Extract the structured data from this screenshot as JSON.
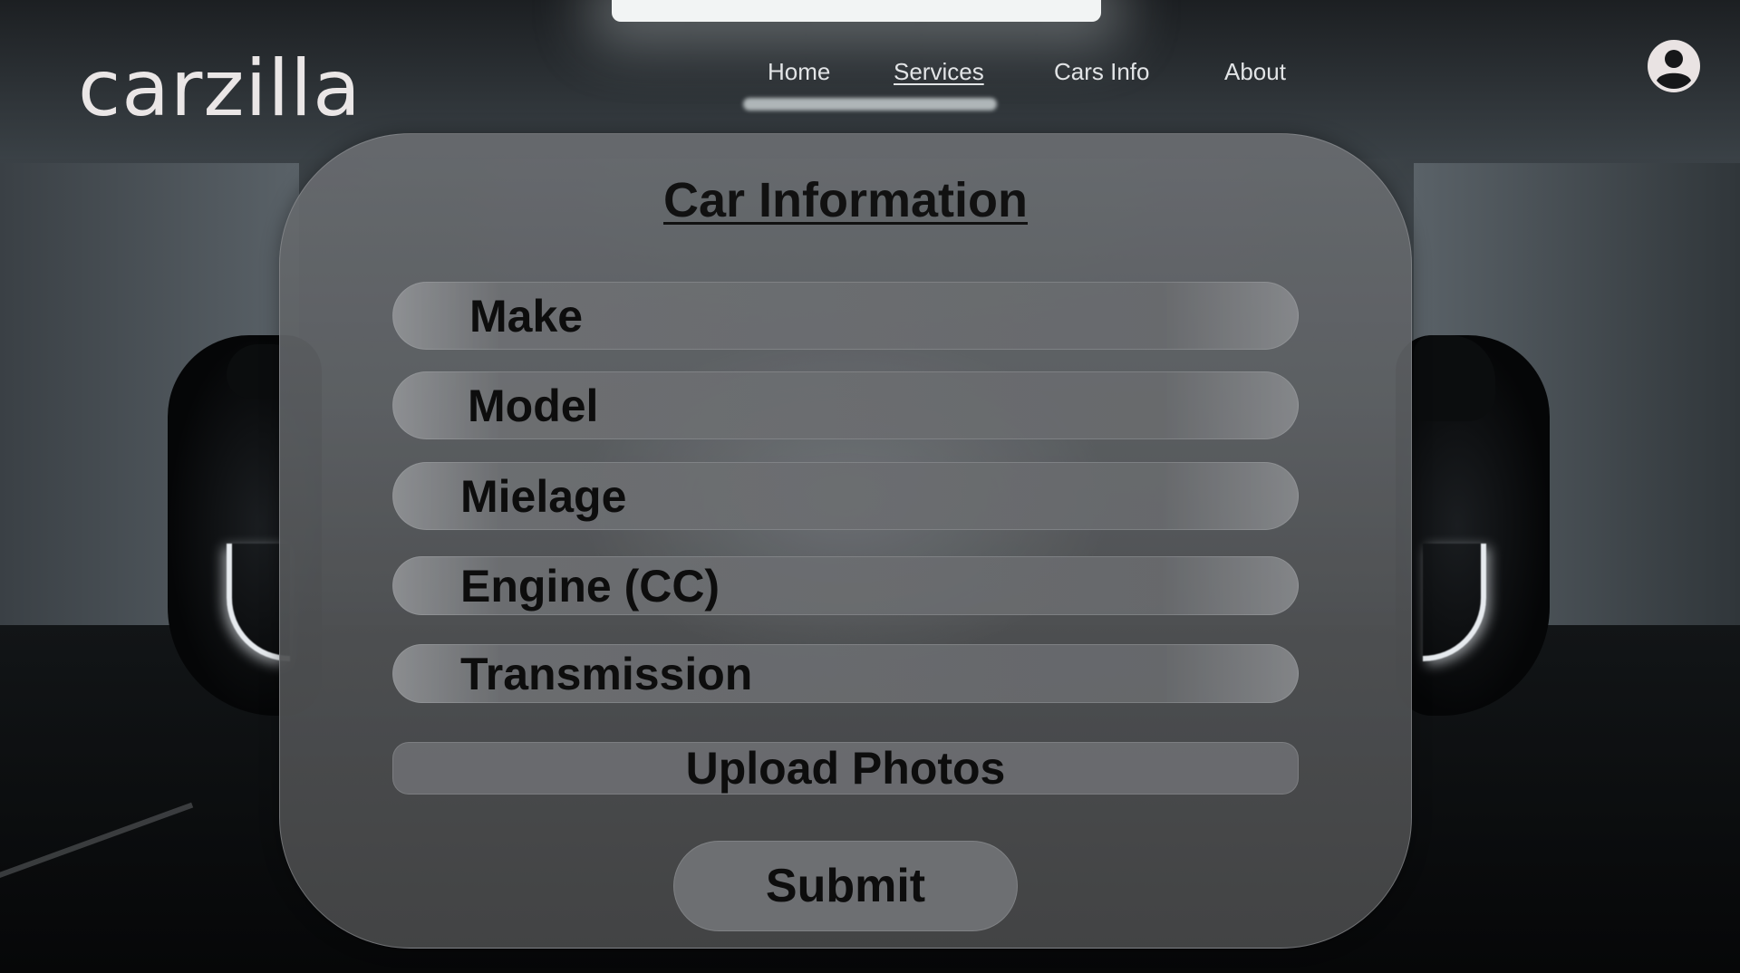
{
  "brand": {
    "logo_text": "carzilla"
  },
  "nav": {
    "items": [
      {
        "label": "Home",
        "active": false
      },
      {
        "label": "Services",
        "active": true
      },
      {
        "label": "Cars Info",
        "active": false
      },
      {
        "label": "About",
        "active": false
      }
    ]
  },
  "header": {
    "account_icon": "user-account-icon"
  },
  "form": {
    "title": "Car Information",
    "fields": [
      {
        "label": "Make"
      },
      {
        "label": "Model"
      },
      {
        "label": "Mielage"
      },
      {
        "label": "Engine (CC)"
      },
      {
        "label": "Transmission"
      }
    ],
    "upload_label": "Upload Photos",
    "submit_label": "Submit"
  },
  "colors": {
    "panel": "#5c5f62",
    "field": "#6b6d70",
    "text_dark": "#0d0d0d",
    "nav_text": "#e2e4e6",
    "logo": "#eae6e6"
  }
}
